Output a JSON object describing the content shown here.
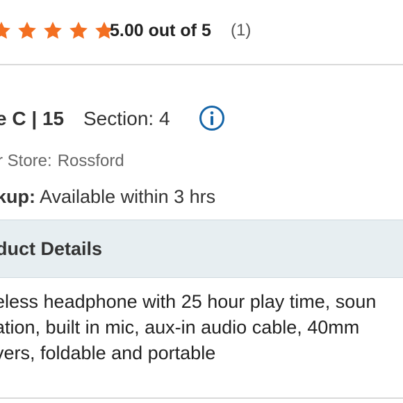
{
  "rating": {
    "stars_filled": 5,
    "stars_total": 5,
    "star_color": "#f36f21",
    "summary": "5.00 out of 5",
    "count": "(1)"
  },
  "location": {
    "aisle": "e C | 15",
    "section": "Section: 4",
    "info_icon": "info-circle-icon",
    "info_icon_color": "#1565a8"
  },
  "store": {
    "label": "r Store:",
    "name": "Rossford"
  },
  "pickup": {
    "label": "kup:",
    "value": " Available within 3 hrs"
  },
  "details": {
    "header": "duct Details",
    "header_bg": "#e7eef1",
    "description_lines": [
      "eless headphone with 25 hour play time, soun",
      "ation, built in mic, aux-in audio cable, 40mm",
      "vers, foldable and portable"
    ]
  }
}
